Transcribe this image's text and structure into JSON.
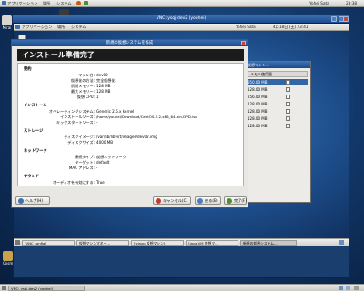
{
  "host": {
    "panel": {
      "apps": "アプリケーション",
      "places": "場所",
      "system": "システム",
      "user": "Yohei Sata",
      "clock": "23:38"
    },
    "desktop_icons": [
      "Mirai",
      "Cohuk",
      "CosmicBreak"
    ],
    "taskbar": {
      "active": "VNC: ysqj-dev2 (youhei)"
    }
  },
  "vnc": {
    "title": "VNC: ysqj-dev2 (youhei)"
  },
  "guest": {
    "panel": {
      "apps": "アプリケーション",
      "places": "場所",
      "system": "システム",
      "user": "Yohei Sata",
      "date": "4月18日 (土) 23:41"
    },
    "taskbar": [
      "[VNC config]",
      "仮想マシンマネー...",
      "[winxp 仮想マシン]",
      "[Java-VM 仮想マ...",
      "新規の仮想システム..."
    ]
  },
  "virt_manager": {
    "title": "仮想マシン...",
    "header": "メモリ使用量",
    "rows": [
      {
        "mem": "850.00 MB",
        "cpu": "1"
      },
      {
        "mem": "128.00 MB",
        "cpu": "1"
      },
      {
        "mem": "256.00 MB",
        "cpu": "1"
      },
      {
        "mem": "128.00 MB",
        "cpu": "1"
      },
      {
        "mem": "128.00 MB",
        "cpu": "1"
      },
      {
        "mem": "128.00 MB",
        "cpu": "1"
      },
      {
        "mem": "128.00 MB",
        "cpu": "1"
      }
    ]
  },
  "dialog": {
    "title": "新規の仮想システムを作成",
    "header": "インストール準備完了",
    "sections": {
      "general": "要約",
      "install": "インストール",
      "storage": "ストレージ",
      "network": "ネットワーク",
      "sound": "サウンド"
    },
    "rows": [
      {
        "label": "マシン名:",
        "value": "dev02"
      },
      {
        "label": "仮想化の方法:",
        "value": "完全仮想化"
      },
      {
        "label": "初期メモリー:",
        "value": "128 MB"
      },
      {
        "label": "最大メモリー:",
        "value": "128 MB"
      },
      {
        "label": "仮想 CPU:",
        "value": "1"
      },
      {
        "label": "オペレーティングシステム:",
        "value": "Generic 2.6.x kernel"
      },
      {
        "label": "インストールソース:",
        "value": "/home/youhei/Download/CentOS-5.2-x86_64-bin-DVD.iso"
      },
      {
        "label": "キックスタートソース:",
        "value": "-"
      },
      {
        "label": "ディスクイメージ:",
        "value": "/var/lib/libvirt/images/dev02.img"
      },
      {
        "label": "ディスクサイズ:",
        "value": "4000 MB"
      },
      {
        "label": "接続タイプ:",
        "value": "仮想ネットワーク"
      },
      {
        "label": "ターゲット:",
        "value": "default"
      },
      {
        "label": "MAC アドレス:",
        "value": "-"
      },
      {
        "label": "オーディオを有効にする:",
        "value": "True"
      }
    ],
    "buttons": {
      "help": "ヘルプ(H)",
      "cancel": "キャンセル(C)",
      "back": "戻る(B)",
      "finish": "完了(F)"
    }
  },
  "colors": {
    "title_blue": "#1c4a8a",
    "accent_blue": "#3b6fb0",
    "selection": "#3465a4"
  }
}
